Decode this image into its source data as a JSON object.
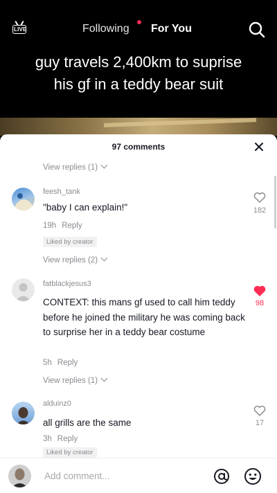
{
  "nav": {
    "live_label": "LIVE",
    "following_label": "Following",
    "foryou_label": "For You"
  },
  "caption": {
    "line1": "guy travels 2,400km to suprise",
    "line2": "his gf in a teddy bear suit"
  },
  "comments_panel": {
    "title": "97 comments",
    "view_replies_top": "View replies (1)",
    "comments": [
      {
        "username": "feesh_tank",
        "text": "\"baby I can explain!\"",
        "time": "19h",
        "reply_label": "Reply",
        "liked_by_creator": "Liked by creator",
        "likes": "182",
        "liked": false,
        "view_replies": "View replies (2)"
      },
      {
        "username": "fatblackjesus3",
        "text": "CONTEXT: this mans gf used to call him teddy before he joined the military he was coming back to surprise her in a teddy bear costume",
        "time": "5h",
        "reply_label": "Reply",
        "likes": "98",
        "liked": true,
        "view_replies": "View replies (1)"
      },
      {
        "username": "alduinz0",
        "text": "all grills are the same",
        "time": "3h",
        "reply_label": "Reply",
        "liked_by_creator": "Liked by creator",
        "likes": "17",
        "liked": false
      }
    ]
  },
  "add_comment": {
    "placeholder": "Add comment..."
  },
  "colors": {
    "accent": "#fe2c55",
    "muted_text": "#8a8b91"
  }
}
